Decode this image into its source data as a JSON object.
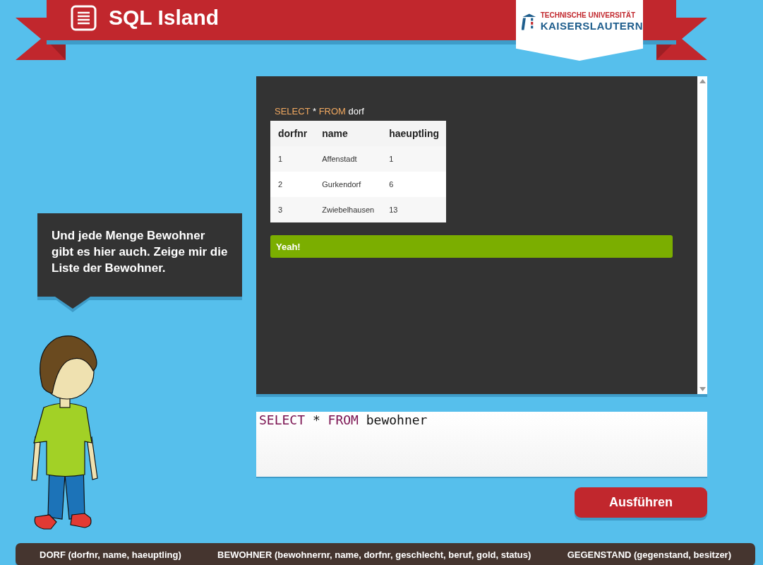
{
  "header": {
    "title": "SQL Island",
    "logo_lines": [
      "TECHNISCHE UNIVERSITÄT",
      "KAISERSLAUTERN"
    ]
  },
  "speech": {
    "text": "Und jede Menge Bewohner gibt es hier auch. Zeige mir die Liste der Bewohner."
  },
  "output": {
    "query_tokens": [
      {
        "text": "SELECT",
        "kind": "keyword"
      },
      {
        "text": "*",
        "kind": "plain"
      },
      {
        "text": "FROM",
        "kind": "keyword"
      },
      {
        "text": "dorf",
        "kind": "plain"
      }
    ],
    "table": {
      "columns": [
        "dorfnr",
        "name",
        "haeuptling"
      ],
      "rows": [
        [
          "1",
          "Affenstadt",
          "1"
        ],
        [
          "2",
          "Gurkendorf",
          "6"
        ],
        [
          "3",
          "Zwiebelhausen",
          "13"
        ]
      ]
    },
    "alert": {
      "text": "Yeah!",
      "kind": "success"
    }
  },
  "editor": {
    "tokens": [
      {
        "text": "SELECT",
        "kind": "keyword"
      },
      {
        "text": "*",
        "kind": "plain"
      },
      {
        "text": "FROM",
        "kind": "keyword"
      },
      {
        "text": "bewohner",
        "kind": "plain"
      }
    ]
  },
  "run_button": {
    "label": "Ausführen"
  },
  "footer": {
    "tables": [
      "DORF (dorfnr, name, haeuptling)",
      "BEWOHNER (bewohnernr, name, dorfnr, geschlecht, beruf, gold, status)",
      "GEGENSTAND (gegenstand, besitzer)"
    ]
  }
}
